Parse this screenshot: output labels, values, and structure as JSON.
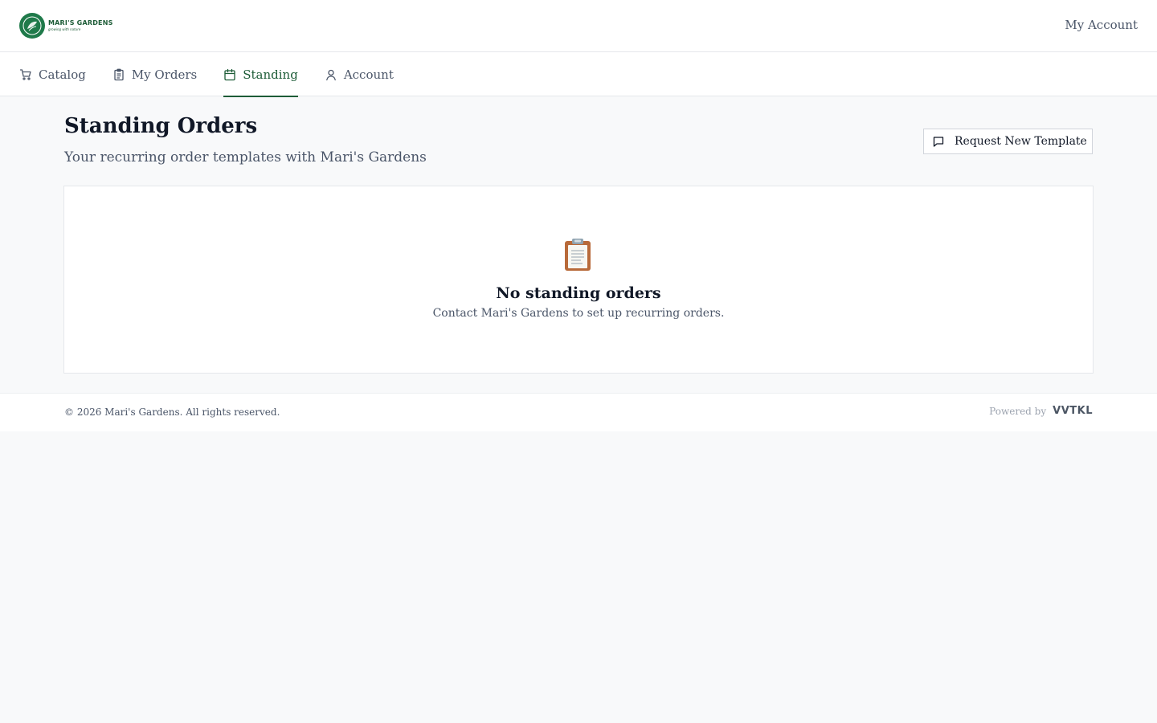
{
  "brand": {
    "name": "MARI'S GARDENS",
    "tagline": "growing with nature",
    "colors": {
      "primary": "#1d5c37",
      "logo_bg": "#1f7a4a"
    }
  },
  "header": {
    "account_link": "My Account"
  },
  "nav": {
    "tabs": [
      {
        "label": "Catalog",
        "icon": "cart-icon",
        "active": false
      },
      {
        "label": "My Orders",
        "icon": "clipboard-list-icon",
        "active": false
      },
      {
        "label": "Standing",
        "icon": "calendar-icon",
        "active": true
      },
      {
        "label": "Account",
        "icon": "user-icon",
        "active": false
      }
    ]
  },
  "main": {
    "title": "Standing Orders",
    "subtitle": "Your recurring order templates with Mari's Gardens",
    "request_button": {
      "label": "Request New Template",
      "icon": "message-square-icon"
    },
    "empty_state": {
      "icon": "clipboard-icon",
      "title": "No standing orders",
      "description": "Contact Mari's Gardens to set up recurring orders."
    }
  },
  "footer": {
    "copyright": "© 2026 Mari's Gardens. All rights reserved.",
    "powered_by": "Powered by",
    "powered_logo": "VVTKL"
  }
}
